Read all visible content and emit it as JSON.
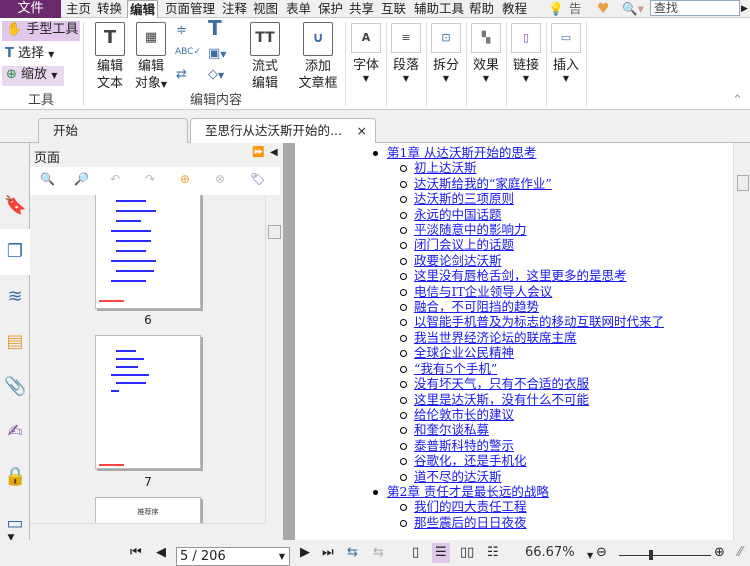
{
  "menu": {
    "file": "文件",
    "items": [
      "主页",
      "转换",
      "编辑",
      "页面管理",
      "注释",
      "视图",
      "表单",
      "保护",
      "共享",
      "互联",
      "辅助工具",
      "帮助",
      "教程"
    ],
    "active": "编辑",
    "tell_me": "告诉",
    "search_placeholder": "查找"
  },
  "ribbon": {
    "tools": {
      "hand": "手型工具",
      "select": "选择",
      "zoom": "缩放",
      "group": "工具"
    },
    "edit": {
      "edit_text": [
        "编辑",
        "文本"
      ],
      "edit_object": [
        "编辑",
        "对象"
      ],
      "flow_edit": [
        "流式",
        "编辑"
      ],
      "add_textbox": [
        "添加",
        "文章框"
      ],
      "group": "编辑内容"
    },
    "buttons": [
      "字体",
      "段落",
      "拆分",
      "效果",
      "链接",
      "插入"
    ]
  },
  "tabs": [
    {
      "label": "开始"
    },
    {
      "label": "至思行从达沃斯开始的...",
      "close": "×"
    }
  ],
  "panel": {
    "title": "页面",
    "thumbnails": [
      {
        "page": "6"
      },
      {
        "page": "7"
      }
    ],
    "next_thumb_title": "推荐序"
  },
  "document": {
    "chapters": [
      {
        "title": "第1章 从达沃斯开始的思考",
        "sections": [
          "初上达沃斯",
          "达沃斯给我的“家庭作业”",
          "达沃斯的三项原则",
          "永远的中国话题",
          "平淡随意中的影响力",
          "闭门会议上的话题",
          "政要论剑达沃斯",
          "这里没有唇枪舌剑，这里更多的是思考",
          "电信与IT企业领导人会议",
          "融合，不可阻挡的趋势",
          "以智能手机普及为标志的移动互联网时代来了",
          "我当世界经济论坛的联席主席",
          "全球企业公民精神",
          "“我有5个手机”",
          "没有坏天气，只有不合适的衣服",
          "这里是达沃斯，没有什么不可能",
          "给伦敦市长的建议",
          "和奎尔谈私募",
          "泰普斯科特的警示",
          "谷歌化，还是手机化",
          "道不尽的达沃斯"
        ]
      },
      {
        "title": "第2章 责任才是最长远的战略",
        "sections": [
          "我们的四大责任工程",
          "那些震后的日日夜夜"
        ]
      }
    ]
  },
  "status": {
    "page": "5 / 206",
    "zoom": "66.67%",
    "zoom_slider_fraction": 0.35
  },
  "colors": {
    "accent": "#6b2a6b",
    "hand_active": "#e0c8ea",
    "link": "#1a1aee"
  }
}
